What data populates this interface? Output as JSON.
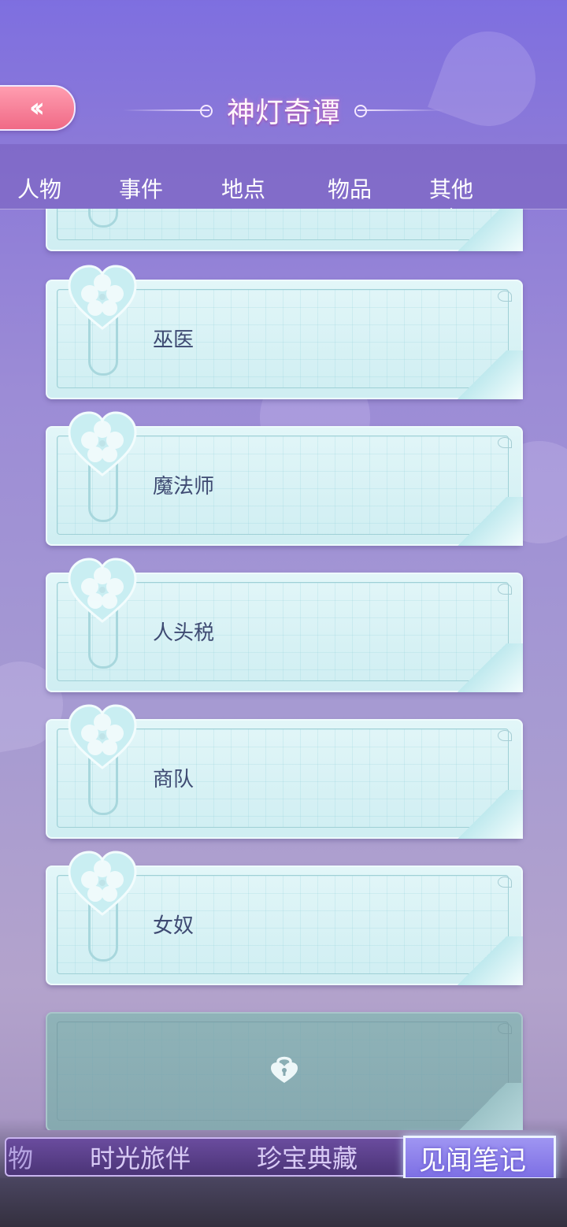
{
  "header": {
    "title": "神灯奇谭",
    "back_icon": "double-chevron-left-icon"
  },
  "tabs": [
    {
      "label": "人物",
      "active": false
    },
    {
      "label": "事件",
      "active": false
    },
    {
      "label": "地点",
      "active": false
    },
    {
      "label": "物品",
      "active": false
    },
    {
      "label": "其他",
      "active": true
    }
  ],
  "entries": [
    {
      "label": "巫医",
      "locked": false
    },
    {
      "label": "魔法师",
      "locked": false
    },
    {
      "label": "人头税",
      "locked": false
    },
    {
      "label": "商队",
      "locked": false
    },
    {
      "label": "女奴",
      "locked": false
    },
    {
      "label": "",
      "locked": true,
      "icon": "heart-lock-icon"
    }
  ],
  "bottom_nav": {
    "partial_label": "物",
    "items": [
      {
        "label": "时光旅伴"
      },
      {
        "label": "珍宝典藏"
      },
      {
        "label": "见闻笔记",
        "active": true
      }
    ]
  },
  "colors": {
    "card_text": "#3e4a72",
    "back_button": "#f06a86",
    "card_bg": "#d9f2f5"
  }
}
